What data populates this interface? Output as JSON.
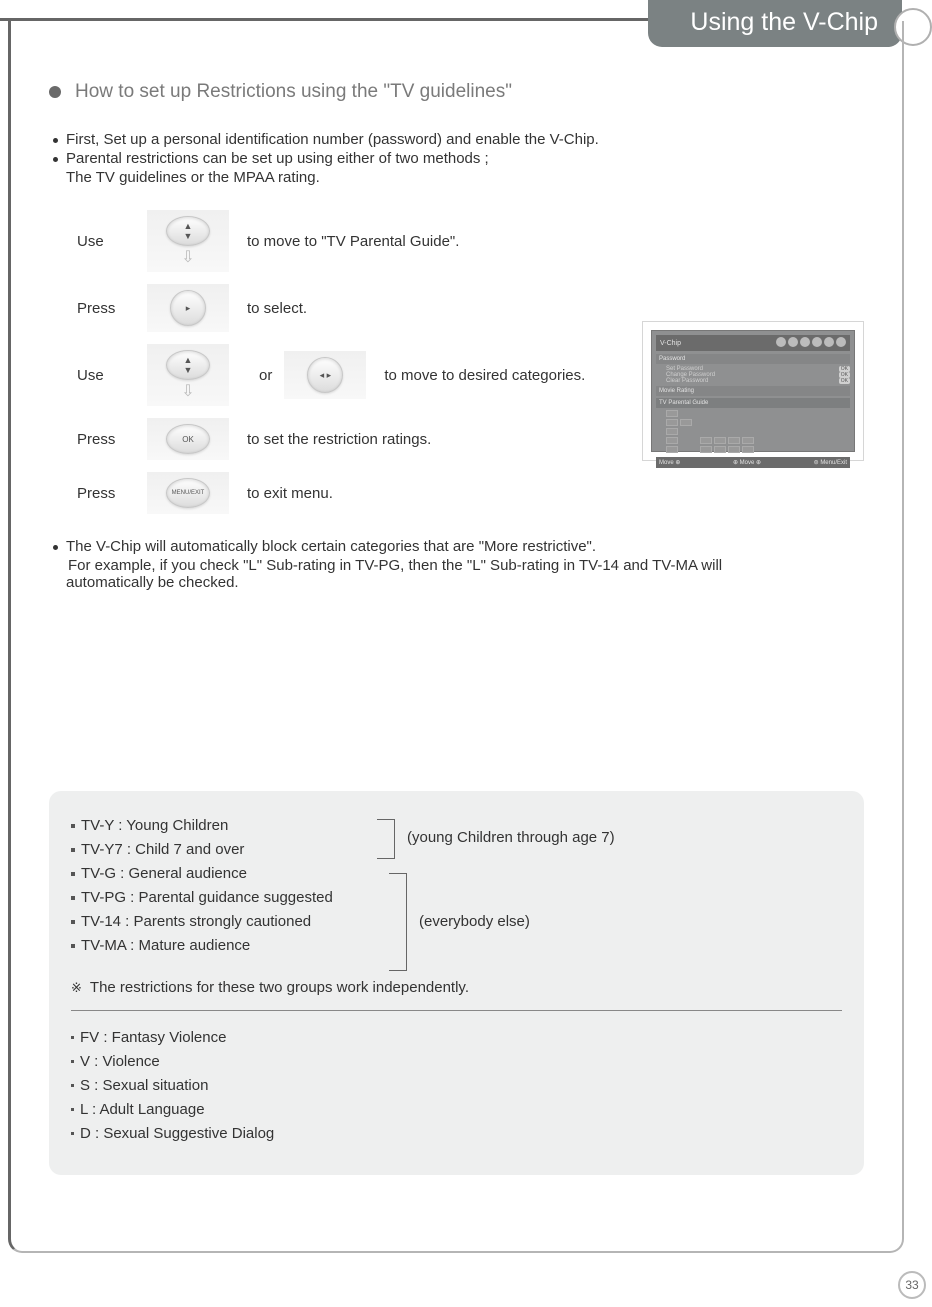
{
  "tab_title": "Using the V-Chip",
  "section_title": "How to set up Restrictions using the \"TV guidelines\"",
  "intro_bullets": {
    "b1": "First, Set up a personal identification number (password) and enable the V-Chip.",
    "b2": "Parental restrictions can be set up using either of two methods ;",
    "b2_cont": "The TV guidelines or the MPAA rating."
  },
  "steps": {
    "s1_label": "Use",
    "s1_text": "to move to \"TV Parental Guide\".",
    "s2_label": "Press",
    "s2_text": "to select.",
    "s3_label": "Use",
    "s3_or": "or",
    "s3_text": "to move to desired categories.",
    "s4_label": "Press",
    "s4_btn": "OK",
    "s4_text": "to set the restriction ratings.",
    "s5_label": "Press",
    "s5_btn": "MENU/EXIT",
    "s5_text": "to exit menu."
  },
  "note_bullet": "The V-Chip will automatically block certain categories that are \"More restrictive\".",
  "note_cont1": "For example, if you check \"L\" Sub-rating in TV-PG, then the \"L\" Sub-rating in TV-14 and TV-MA will",
  "note_cont2": "automatically be checked.",
  "osd": {
    "title": "V-Chip",
    "sec1": "Password",
    "i1": "Set Password",
    "i2": "Change Password",
    "i3": "Clear Password",
    "ok": "OK",
    "sec2": "Movie Rating",
    "sec3": "TV Parental Guide",
    "foot_move": "Move",
    "foot_menu": "Menu/Exit"
  },
  "ratings": {
    "r1": "TV-Y : Young Children",
    "r2": "TV-Y7 : Child 7 and over",
    "r3": "TV-G : General audience",
    "r4": "TV-PG : Parental guidance suggested",
    "r5": "TV-14 : Parents strongly cautioned",
    "r6": "TV-MA : Mature audience",
    "grp1": "(young Children through age 7)",
    "grp2": "(everybody else)"
  },
  "note2_sym": "※",
  "note2": "The restrictions for these two groups work independently.",
  "subratings": {
    "s1": "FV : Fantasy Violence",
    "s2": "V : Violence",
    "s3": "S : Sexual situation",
    "s4": "L :  Adult Language",
    "s5": "D : Sexual Suggestive Dialog"
  },
  "page_number": "33"
}
